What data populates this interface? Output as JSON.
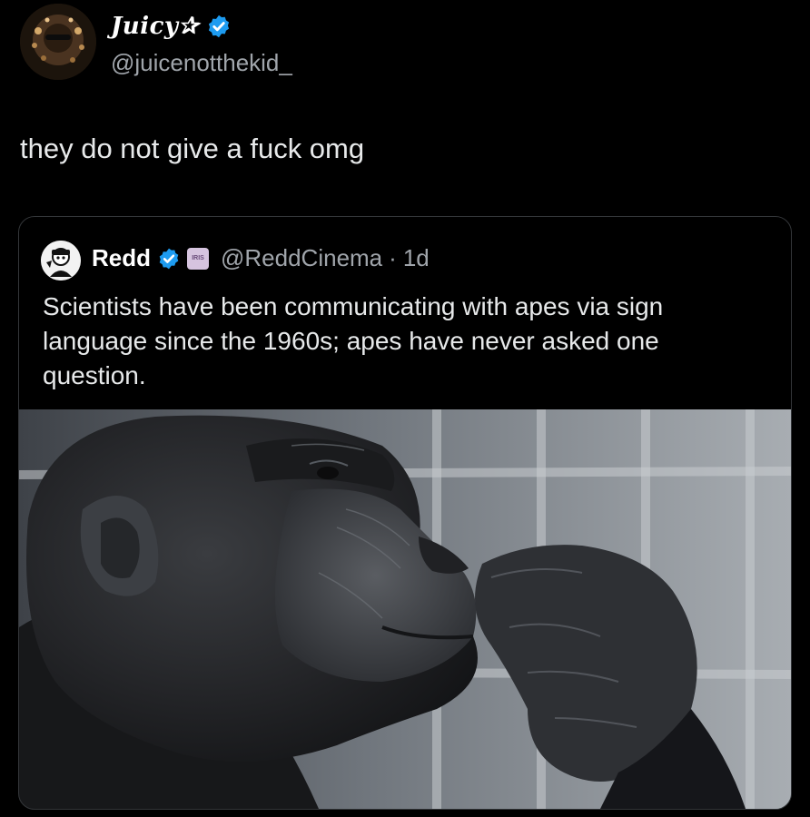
{
  "author": {
    "display_name": "Juicy✰",
    "handle": "@juicenotthekid_",
    "avatar_icon": "avatar-photo-icon",
    "verified_icon": "verified-badge-icon",
    "verified_color": "#1d9bf0"
  },
  "tweet": {
    "text": "they do not give a fuck omg"
  },
  "quoted_tweet": {
    "display_name": "Redd",
    "handle": "@ReddCinema",
    "separator": "·",
    "time": "1d",
    "badge_text": "IRIS",
    "text": "Scientists  have been communicating with apes via sign language since the 1960s; apes have never asked one question.",
    "image_icon": "gorilla-photo"
  },
  "colors": {
    "background": "#000000",
    "text_primary": "#e7e9ea",
    "text_secondary": "#a0a5ab",
    "border": "#333639"
  }
}
